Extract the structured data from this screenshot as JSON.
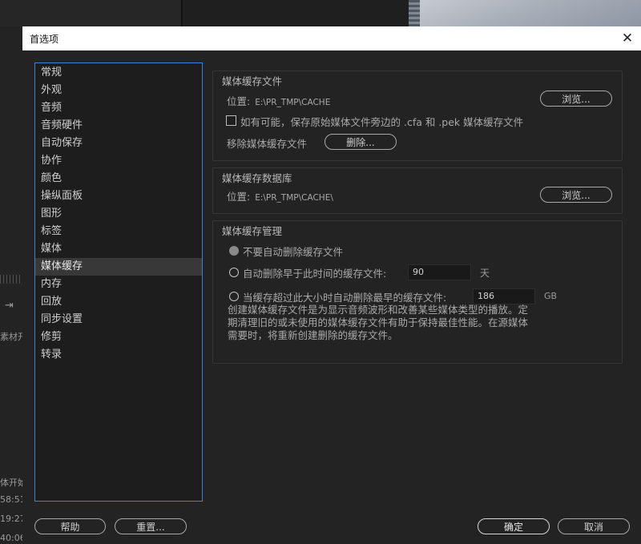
{
  "background": {
    "partial_texts": [
      "素材开",
      "体开始",
      "58:51",
      "19:27",
      "40:06"
    ]
  },
  "dialog": {
    "title": "首选项",
    "close_icon": "close-icon"
  },
  "categories": [
    {
      "label": "常规"
    },
    {
      "label": "外观"
    },
    {
      "label": "音频"
    },
    {
      "label": "音频硬件"
    },
    {
      "label": "自动保存"
    },
    {
      "label": "协作"
    },
    {
      "label": "颜色"
    },
    {
      "label": "操纵面板"
    },
    {
      "label": "图形"
    },
    {
      "label": "标签"
    },
    {
      "label": "媒体"
    },
    {
      "label": "媒体缓存",
      "selected": true
    },
    {
      "label": "内存"
    },
    {
      "label": "回放"
    },
    {
      "label": "同步设置"
    },
    {
      "label": "修剪"
    },
    {
      "label": "转录"
    }
  ],
  "media_cache_files": {
    "title": "媒体缓存文件",
    "location_label": "位置:",
    "location_value": "E:\\PR_TMP\\CACHE",
    "browse_label": "浏览...",
    "save_beside_originals_label": "如有可能，保存原始媒体文件旁边的 .cfa 和 .pek 媒体缓存文件",
    "save_beside_originals_checked": false,
    "remove_label": "移除媒体缓存文件",
    "delete_label": "删除..."
  },
  "media_cache_db": {
    "title": "媒体缓存数据库",
    "location_label": "位置:",
    "location_value": "E:\\PR_TMP\\CACHE\\",
    "browse_label": "浏览..."
  },
  "media_cache_management": {
    "title": "媒体缓存管理",
    "option_no_auto_delete": "不要自动删除缓存文件",
    "option_delete_older": "自动删除早于此时间的缓存文件:",
    "older_value": "90",
    "older_unit": "天",
    "option_delete_when_exceeds": "当缓存超过此大小时自动删除最早的缓存文件:",
    "size_value": "186",
    "size_unit": "GB",
    "description_lines": [
      "创建媒体缓存文件是为显示音频波形和改善某些媒体类型的播放。定",
      "期清理旧的或未使用的媒体缓存文件有助于保持最佳性能。在源媒体",
      "需要时，将重新创建删除的缓存文件。"
    ]
  },
  "footer": {
    "help_label": "帮助",
    "reset_label": "重置...",
    "ok_label": "确定",
    "cancel_label": "取消"
  }
}
